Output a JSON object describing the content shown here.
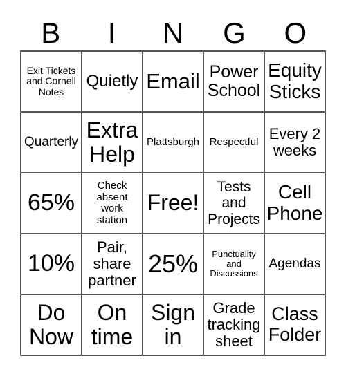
{
  "header": [
    "B",
    "I",
    "N",
    "G",
    "O"
  ],
  "cells": [
    {
      "lines": [
        "Exit Tickets",
        "and Cornell",
        "Notes"
      ],
      "size": 14
    },
    {
      "lines": [
        "Quietly"
      ],
      "size": 24
    },
    {
      "lines": [
        "Email"
      ],
      "size": 31
    },
    {
      "lines": [
        "Power",
        "School"
      ],
      "size": 25
    },
    {
      "lines": [
        "Equity",
        "Sticks"
      ],
      "size": 28
    },
    {
      "lines": [
        "Quarterly"
      ],
      "size": 19
    },
    {
      "lines": [
        "Extra",
        "Help"
      ],
      "size": 32
    },
    {
      "lines": [
        "Plattsburgh"
      ],
      "size": 15
    },
    {
      "lines": [
        "Respectful"
      ],
      "size": 15
    },
    {
      "lines": [
        "Every 2",
        "weeks"
      ],
      "size": 22
    },
    {
      "lines": [
        "65%"
      ],
      "size": 34
    },
    {
      "lines": [
        "Check",
        "absent",
        "work",
        "station"
      ],
      "size": 15
    },
    {
      "lines": [
        "Free!"
      ],
      "size": 32
    },
    {
      "lines": [
        "Tests",
        "and",
        "Projects"
      ],
      "size": 21
    },
    {
      "lines": [
        "Cell",
        "Phone"
      ],
      "size": 28
    },
    {
      "lines": [
        "10%"
      ],
      "size": 34
    },
    {
      "lines": [
        "Pair,",
        "share",
        "partner"
      ],
      "size": 22
    },
    {
      "lines": [
        "25%"
      ],
      "size": 36
    },
    {
      "lines": [
        "Punctuality",
        "and",
        "Discussions"
      ],
      "size": 13
    },
    {
      "lines": [
        "Agendas"
      ],
      "size": 19
    },
    {
      "lines": [
        "Do",
        "Now"
      ],
      "size": 32
    },
    {
      "lines": [
        "On",
        "time"
      ],
      "size": 32
    },
    {
      "lines": [
        "Sign",
        "in"
      ],
      "size": 32
    },
    {
      "lines": [
        "Grade",
        "tracking",
        "sheet"
      ],
      "size": 22
    },
    {
      "lines": [
        "Class",
        "Folder"
      ],
      "size": 27
    }
  ]
}
